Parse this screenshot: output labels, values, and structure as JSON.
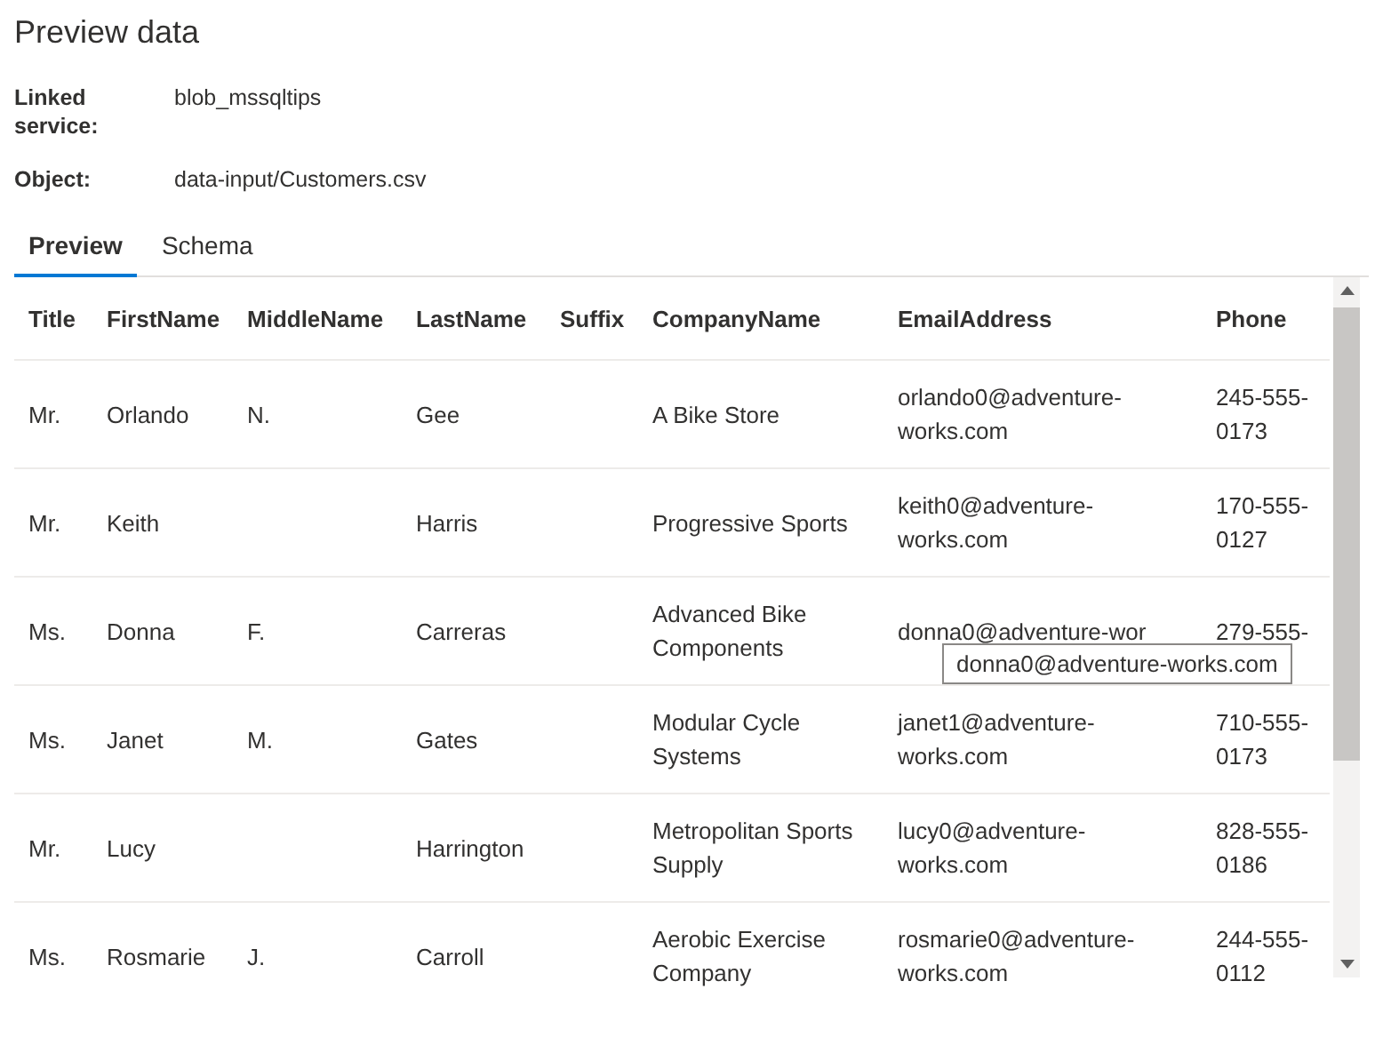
{
  "title": "Preview data",
  "details": [
    {
      "label": "Linked service:",
      "value": "blob_mssqltips"
    },
    {
      "label": "Object:",
      "value": "data-input/Customers.csv"
    }
  ],
  "tabs": [
    {
      "label": "Preview",
      "selected": true
    },
    {
      "label": "Schema",
      "selected": false
    }
  ],
  "table": {
    "columns": [
      "Title",
      "FirstName",
      "MiddleName",
      "LastName",
      "Suffix",
      "CompanyName",
      "EmailAddress",
      "Phone"
    ],
    "rows": [
      [
        "Mr.",
        "Orlando",
        "N.",
        "Gee",
        "",
        "A Bike Store",
        "orlando0@adventure-works.com",
        "245-555-0173"
      ],
      [
        "Mr.",
        "Keith",
        "",
        "Harris",
        "",
        "Progressive Sports",
        "keith0@adventure-works.com",
        "170-555-0127"
      ],
      [
        "Ms.",
        "Donna",
        "F.",
        "Carreras",
        "",
        "Advanced Bike Components",
        "donna0@adventure-wor",
        "279-555-"
      ],
      [
        "Ms.",
        "Janet",
        "M.",
        "Gates",
        "",
        "Modular Cycle Systems",
        "janet1@adventure-works.com",
        "710-555-0173"
      ],
      [
        "Mr.",
        "Lucy",
        "",
        "Harrington",
        "",
        "Metropolitan Sports Supply",
        "lucy0@adventure-works.com",
        "828-555-0186"
      ],
      [
        "Ms.",
        "Rosmarie",
        "J.",
        "Carroll",
        "",
        "Aerobic Exercise Company",
        "rosmarie0@adventure-works.com",
        "244-555-0112"
      ]
    ]
  },
  "tooltip": "donna0@adventure-works.com"
}
